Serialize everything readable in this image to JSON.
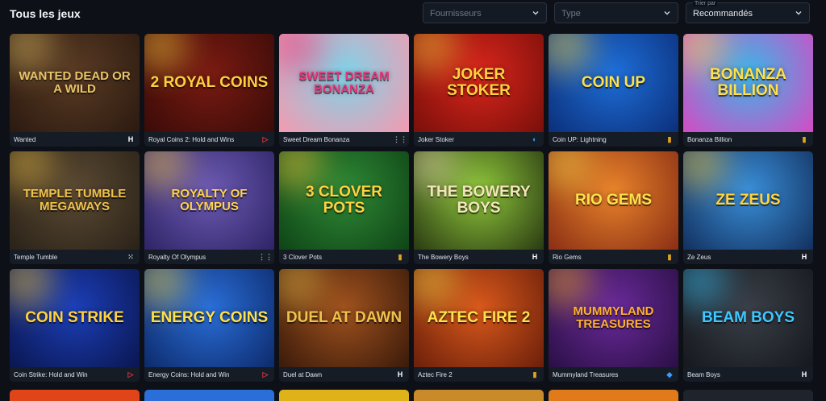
{
  "header": {
    "title": "Tous les jeux",
    "filters": {
      "providers_placeholder": "Fournisseurs",
      "type_placeholder": "Type",
      "sort_caption": "Trier par",
      "sort_value": "Recommandés"
    }
  },
  "games": [
    {
      "name": "Wanted",
      "art": "Wanted Dead or a Wild",
      "bg": "#5a3b24",
      "bg2": "#2b1a10",
      "fg": "#e8c46a",
      "provider_icon": "hacksaw-icon",
      "icon_glyph": "H",
      "icon_color": "#ffffff"
    },
    {
      "name": "Royal Coins 2: Hold and Wins",
      "art": "2 Royal Coins",
      "bg": "#7a1b12",
      "bg2": "#3a0b08",
      "fg": "#ffcf40",
      "provider_icon": "play-triangle-icon",
      "icon_glyph": "▷",
      "icon_color": "#e0383e"
    },
    {
      "name": "Sweet Dream Bonanza",
      "art": "Sweet Dream Bonanza",
      "bg": "#7fd3e8",
      "bg2": "#f49ab0",
      "fg": "#e8357a",
      "provider_icon": "dots-grid-icon",
      "icon_glyph": "⋮⋮",
      "icon_color": "#9aa1ad"
    },
    {
      "name": "Joker Stoker",
      "art": "Joker Stoker",
      "bg": "#d9261c",
      "bg2": "#7a0f0a",
      "fg": "#ffd23f",
      "provider_icon": "spiral-icon",
      "icon_glyph": "◐",
      "icon_color": "#3aa0ff"
    },
    {
      "name": "Coin UP: Lightning",
      "art": "Coin Up",
      "bg": "#1e6fd9",
      "bg2": "#0b2f7a",
      "fg": "#ffe14a",
      "provider_icon": "gold-badge-icon",
      "icon_glyph": "▮",
      "icon_color": "#e0a41e"
    },
    {
      "name": "Bonanza Billion",
      "art": "Bonanza Billion",
      "bg": "#3bb6e8",
      "bg2": "#d44bc4",
      "fg": "#ffe14a",
      "provider_icon": "gold-badge-icon",
      "icon_glyph": "▮",
      "icon_color": "#e0a41e"
    },
    {
      "name": "Temple Tumble",
      "art": "Temple Tumble Megaways",
      "bg": "#5b4a33",
      "bg2": "#2a2218",
      "fg": "#f0c14b",
      "provider_icon": "dots-cross-icon",
      "icon_glyph": "⁙",
      "icon_color": "#dfe3ea"
    },
    {
      "name": "Royalty Of Olympus",
      "art": "Royalty of Olympus",
      "bg": "#6d5bb3",
      "bg2": "#2e2466",
      "fg": "#ffd34d",
      "provider_icon": "dots-grid-icon",
      "icon_glyph": "⋮⋮",
      "icon_color": "#9aa1ad"
    },
    {
      "name": "3 Clover Pots",
      "art": "3 Clover Pots",
      "bg": "#2f8a36",
      "bg2": "#0f4416",
      "fg": "#ffd23f",
      "provider_icon": "gold-badge-icon",
      "icon_glyph": "▮",
      "icon_color": "#e0a41e"
    },
    {
      "name": "The Bowery Boys",
      "art": "The Bowery Boys",
      "bg": "#8fc73b",
      "bg2": "#2a3a12",
      "fg": "#f3e6b8",
      "provider_icon": "hacksaw-icon",
      "icon_glyph": "H",
      "icon_color": "#ffffff"
    },
    {
      "name": "Rio Gems",
      "art": "Rio Gems",
      "bg": "#e8832b",
      "bg2": "#8a2e14",
      "fg": "#ffe14a",
      "provider_icon": "gold-badge-icon",
      "icon_glyph": "▮",
      "icon_color": "#e0a41e"
    },
    {
      "name": "Ze Zeus",
      "art": "Ze Zeus",
      "bg": "#3a8fd9",
      "bg2": "#12305e",
      "fg": "#ffd23f",
      "provider_icon": "hacksaw-icon",
      "icon_glyph": "H",
      "icon_color": "#ffffff"
    },
    {
      "name": "Coin Strike: Hold and Win",
      "art": "Coin Strike",
      "bg": "#1c3fb8",
      "bg2": "#0a1650",
      "fg": "#ffd23f",
      "provider_icon": "play-triangle-icon",
      "icon_glyph": "▷",
      "icon_color": "#e0383e"
    },
    {
      "name": "Energy Coins: Hold and Win",
      "art": "Energy Coins",
      "bg": "#2a6fd9",
      "bg2": "#0d2a6b",
      "fg": "#ffe14a",
      "provider_icon": "play-triangle-icon",
      "icon_glyph": "▷",
      "icon_color": "#e0383e"
    },
    {
      "name": "Duel at Dawn",
      "art": "Duel at Dawn",
      "bg": "#a0521e",
      "bg2": "#3a1a0a",
      "fg": "#f0c14b",
      "provider_icon": "hacksaw-icon",
      "icon_glyph": "H",
      "icon_color": "#ffffff"
    },
    {
      "name": "Aztec Fire 2",
      "art": "Aztec Fire 2",
      "bg": "#d9591c",
      "bg2": "#6b1f0a",
      "fg": "#ffe14a",
      "provider_icon": "gold-badge-icon",
      "icon_glyph": "▮",
      "icon_color": "#e0a41e"
    },
    {
      "name": "Mummyland Treasures",
      "art": "Mummyland Treasures",
      "bg": "#6a2a9a",
      "bg2": "#2a0f45",
      "fg": "#ffb02e",
      "provider_icon": "drop-icon",
      "icon_glyph": "◆",
      "icon_color": "#3a9cff"
    },
    {
      "name": "Beam Boys",
      "art": "Beam Boys",
      "bg": "#3a3f48",
      "bg2": "#15181d",
      "fg": "#3ec8ff",
      "provider_icon": "hacksaw-icon",
      "icon_glyph": "H",
      "icon_color": "#ffffff"
    }
  ],
  "next_row_colors": [
    "#e0451a",
    "#2a6fd9",
    "#e0b21a",
    "#c98a2a",
    "#e07a1a",
    "#1f232b"
  ]
}
